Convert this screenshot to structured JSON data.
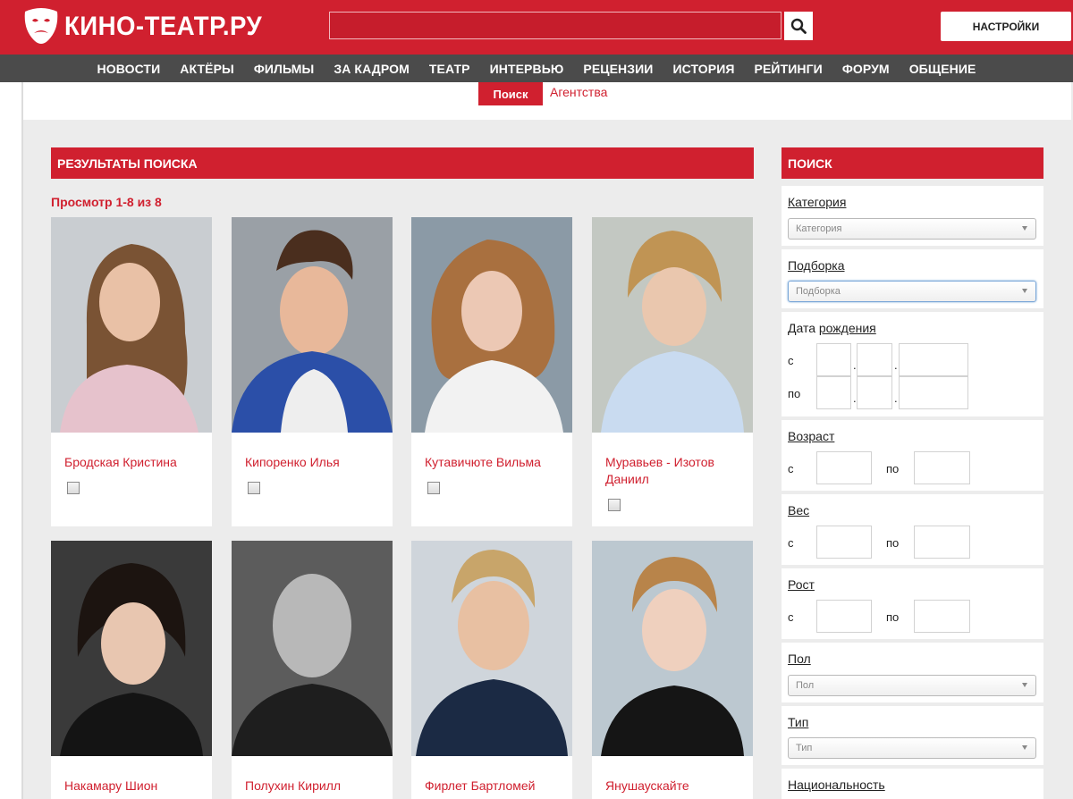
{
  "header": {
    "logo_text": "КИНО-ТЕАТР.РУ",
    "search_placeholder": "",
    "settings_label": "НАСТРОЙКИ"
  },
  "nav": [
    "НОВОСТИ",
    "АКТЁРЫ",
    "ФИЛЬМЫ",
    "ЗА КАДРОМ",
    "ТЕАТР",
    "ИНТЕРВЬЮ",
    "РЕЦЕНЗИИ",
    "ИСТОРИЯ",
    "РЕЙТИНГИ",
    "ФОРУМ",
    "ОБЩЕНИЕ"
  ],
  "subtabs": {
    "active": "Поиск",
    "other": "Агентства"
  },
  "results": {
    "title": "РЕЗУЛЬТАТЫ ПОИСКА",
    "count": "Просмотр 1-8 из 8",
    "actors": [
      {
        "name": "Бродская Кристина"
      },
      {
        "name": "Кипоренко Илья"
      },
      {
        "name": "Кутавичюте Вильма"
      },
      {
        "name": "Муравьев - Изотов Даниил"
      },
      {
        "name": "Накамару Шион"
      },
      {
        "name": "Полухин Кирилл"
      },
      {
        "name": "Фирлет Бартломей"
      },
      {
        "name": "Янушаускайте"
      }
    ]
  },
  "sidebar": {
    "title": "ПОИСК",
    "category": {
      "label": "Категория",
      "placeholder": "Категория"
    },
    "collection": {
      "label": "Подборка",
      "placeholder": "Подборка"
    },
    "birthdate": {
      "label_prefix": "Дата ",
      "label_link": "рождения",
      "from": "с",
      "to": "по",
      "sep": "."
    },
    "age": {
      "label": "Возраст",
      "from": "с",
      "to": "по"
    },
    "weight": {
      "label": "Вес",
      "from": "с",
      "to": "по"
    },
    "height": {
      "label": "Рост",
      "from": "с",
      "to": "по"
    },
    "gender": {
      "label": "Пол",
      "placeholder": "Пол"
    },
    "type": {
      "label": "Тип",
      "placeholder": "Тип"
    },
    "nationality": {
      "label": "Национальность"
    }
  }
}
